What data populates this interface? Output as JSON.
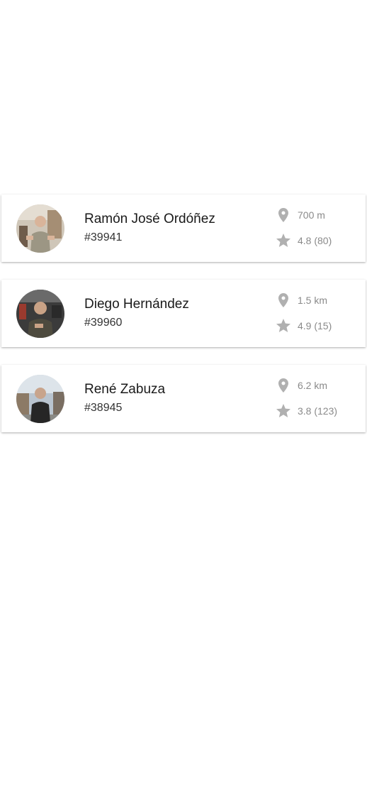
{
  "colors": {
    "icon": "#b0b0b0",
    "meta_text": "#8a8a8a",
    "name_text": "#1a1a1a",
    "background": "#ffffff"
  },
  "icons": {
    "distance": "location-pin-icon",
    "rating": "star-icon"
  },
  "workers": [
    {
      "name": "Ramón José Ordóñez",
      "code": "#39941",
      "distance": "700 m",
      "rating": "4.8 (80)",
      "avatar": "avatar-photo"
    },
    {
      "name": "Diego Hernández",
      "code": "#39960",
      "distance": "1.5 km",
      "rating": "4.9 (15)",
      "avatar": "avatar-photo"
    },
    {
      "name": "René Zabuza",
      "code": "#38945",
      "distance": "6.2 km",
      "rating": "3.8 (123)",
      "avatar": "avatar-photo"
    }
  ]
}
